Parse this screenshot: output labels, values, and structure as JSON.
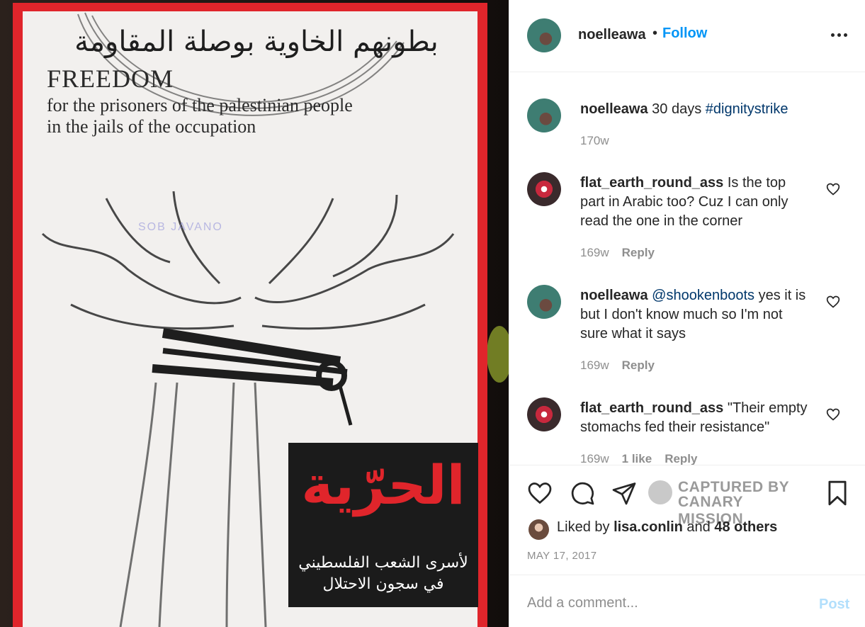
{
  "post": {
    "author": "noelleawa",
    "separator": "•",
    "follow_label": "Follow",
    "more_icon": "more-horizontal-icon"
  },
  "image": {
    "arabic_headline": "بطونهم الخاوية بوصلة المقاومة",
    "english_title": "FREEDOM",
    "english_line1": "for the prisoners of the palestinian people",
    "english_line2": "in the jails of the occupation",
    "reflection_text": "SOB JAVANO",
    "arabic_freedom": "الحرّية",
    "arabic_caption_line1": "لأسرى الشعب الفلسطيني",
    "arabic_caption_line2": "في سجون الاحتلال",
    "poster_border_color": "#e0252b"
  },
  "caption": {
    "username": "noelleawa",
    "text": " 30 days ",
    "hashtag": "#dignitystrike",
    "time": "170w"
  },
  "comments": [
    {
      "username": "flat_earth_round_ass",
      "text": " Is the top part in Arabic too? Cuz I can only read the one in the corner",
      "time": "169w",
      "reply": "Reply"
    },
    {
      "username": "noelleawa",
      "mention": "@shookenboots",
      "text": " yes it is but I don't know much so I'm not sure what it says",
      "time": "169w",
      "reply": "Reply"
    },
    {
      "username": "flat_earth_round_ass",
      "text": " \"Their empty stomachs fed their resistance\"",
      "time": "169w",
      "likes": "1 like",
      "reply": "Reply"
    }
  ],
  "actions": {
    "like_icon": "heart-icon",
    "comment_icon": "comment-icon",
    "share_icon": "paper-plane-icon",
    "save_icon": "bookmark-icon",
    "watermark_line1": "CAPTURED BY",
    "watermark_line2": "CANARY MISSION"
  },
  "likes": {
    "prefix": "Liked by ",
    "user": "lisa.conlin",
    "middle": " and ",
    "others": "48 others"
  },
  "date": "MAY 17, 2017",
  "add_comment": {
    "placeholder": "Add a comment...",
    "post_label": "Post"
  },
  "colors": {
    "link": "#0095f6",
    "hashtag": "#00376b",
    "muted": "#8e8e8e",
    "post_disabled": "#b2dffc"
  }
}
